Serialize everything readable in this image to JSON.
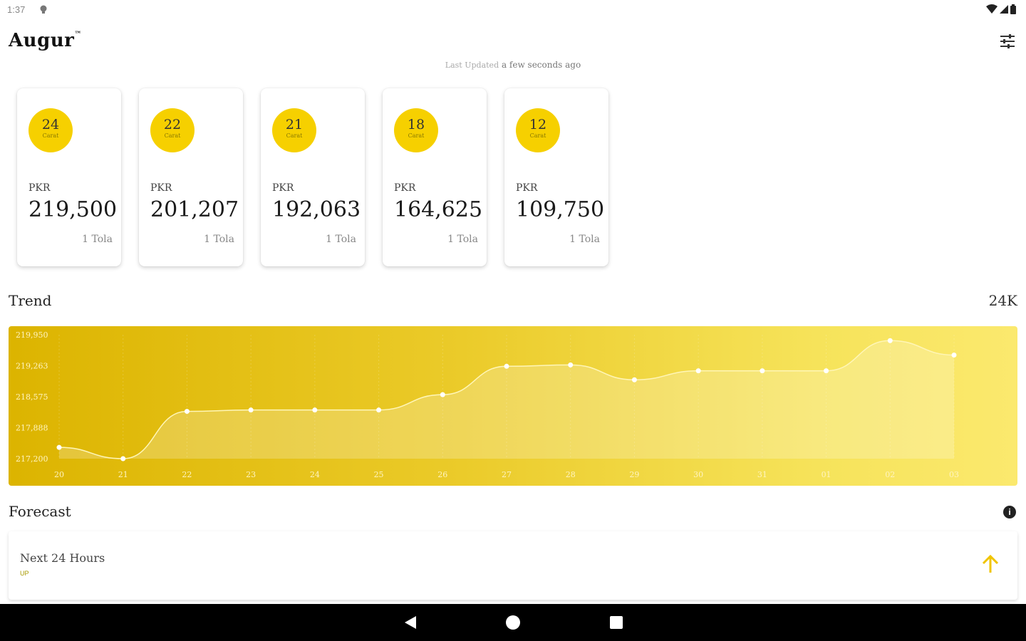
{
  "status": {
    "time": "1:37"
  },
  "header": {
    "title": "Augur",
    "trademark": "™",
    "last_updated_label": "Last Updated",
    "last_updated_value": "a few seconds ago"
  },
  "cards": [
    {
      "karat": "24",
      "karat_unit": "Carat",
      "currency": "PKR",
      "price": "219,500",
      "weight": "1 Tola"
    },
    {
      "karat": "22",
      "karat_unit": "Carat",
      "currency": "PKR",
      "price": "201,207",
      "weight": "1 Tola"
    },
    {
      "karat": "21",
      "karat_unit": "Carat",
      "currency": "PKR",
      "price": "192,063",
      "weight": "1 Tola"
    },
    {
      "karat": "18",
      "karat_unit": "Carat",
      "currency": "PKR",
      "price": "164,625",
      "weight": "1 Tola"
    },
    {
      "karat": "12",
      "karat_unit": "Carat",
      "currency": "PKR",
      "price": "109,750",
      "weight": "1 Tola"
    }
  ],
  "trend": {
    "title": "Trend",
    "range_label": "24K"
  },
  "chart_data": {
    "type": "line",
    "x": [
      "20",
      "21",
      "22",
      "23",
      "24",
      "25",
      "26",
      "27",
      "28",
      "29",
      "30",
      "31",
      "01",
      "02",
      "03"
    ],
    "y_ticks": [
      "219,950",
      "219,263",
      "218,575",
      "217,888",
      "217,200"
    ],
    "ylim": [
      217200,
      219950
    ],
    "values": [
      217450,
      217200,
      218250,
      218280,
      218280,
      218280,
      218620,
      219250,
      219280,
      218950,
      219150,
      219150,
      219150,
      219820,
      219500
    ],
    "grid": true,
    "colors": {
      "line": "#fff6b8",
      "point": "#ffffff",
      "label": "#fff4c0"
    }
  },
  "forecast": {
    "title": "Forecast",
    "info_icon": "i",
    "period_label": "Next 24 Hours",
    "direction": "UP",
    "arrow_color": "#f0c400"
  }
}
